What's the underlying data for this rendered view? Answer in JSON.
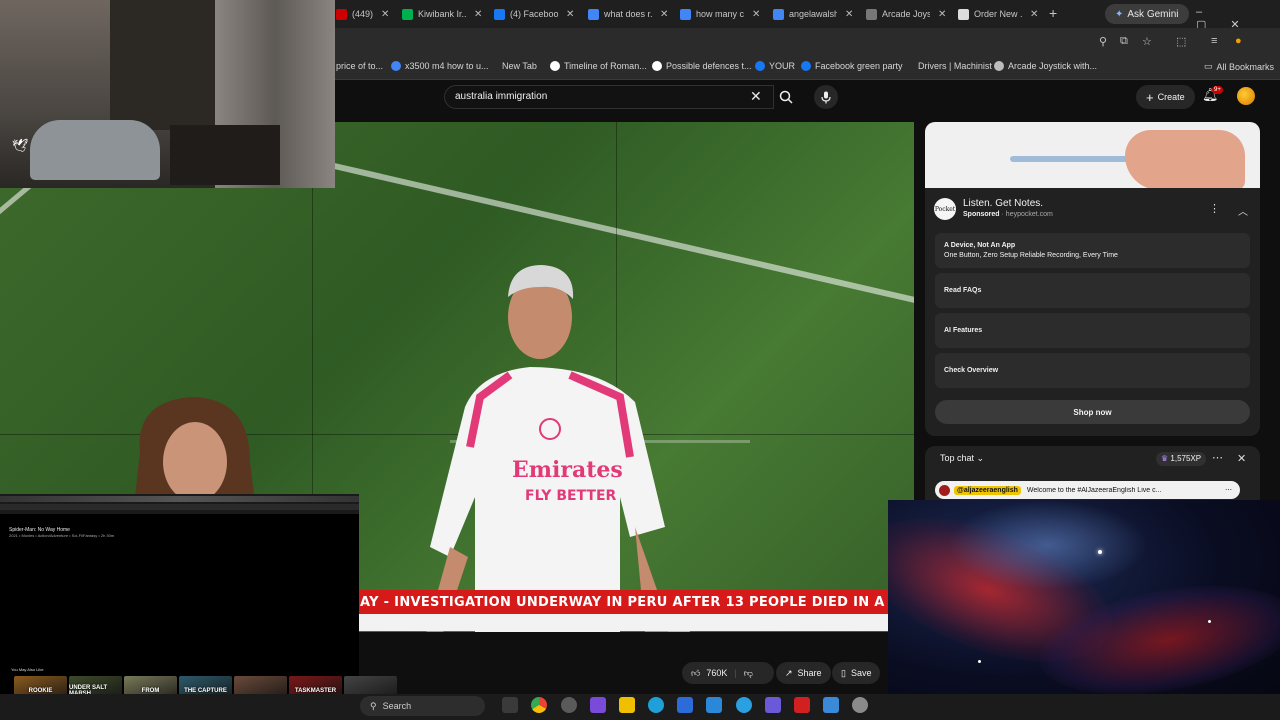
{
  "browser": {
    "tabs": [
      {
        "label": "(449)",
        "favicon_color": "#cc0000"
      },
      {
        "label": "Kiwibank Ir...",
        "favicon_color": "#00b04f"
      },
      {
        "label": "(4) Facebook",
        "favicon_color": "#1877f2"
      },
      {
        "label": "what does r...",
        "favicon_color": "#4285f4"
      },
      {
        "label": "how many c...",
        "favicon_color": "#4285f4"
      },
      {
        "label": "angelawalsh...",
        "favicon_color": "#4285f4"
      },
      {
        "label": "Arcade Joys...",
        "favicon_color": "#777777"
      },
      {
        "label": "Order New ...",
        "favicon_color": "#dddddd"
      }
    ],
    "ask_gemini": "Ask Gemini",
    "new_tab_glyph": "+",
    "bookmarks": [
      {
        "label": "price of to...",
        "favicon_color": ""
      },
      {
        "label": "x3500 m4 how to u...",
        "favicon_color": "#4285f4"
      },
      {
        "label": "New Tab",
        "favicon_color": ""
      },
      {
        "label": "Timeline of Roman...",
        "favicon_color": "#ffffff"
      },
      {
        "label": "Possible defences t...",
        "favicon_color": "#ffffff"
      },
      {
        "label": "YOUR",
        "favicon_color": "#1877f2"
      },
      {
        "label": "Facebook green party",
        "favicon_color": "#1877f2"
      },
      {
        "label": "Drivers | Machinist",
        "favicon_color": ""
      },
      {
        "label": "Arcade Joystick with...",
        "favicon_color": "#bbbbbb"
      }
    ],
    "all_bookmarks": "All Bookmarks"
  },
  "youtube": {
    "search_value": "australia immigration",
    "create_label": "Create",
    "notification_count": "9+"
  },
  "video": {
    "ticker_text": "AY  -  INVESTIGATION UNDERWAY IN PERU AFTER 13 PEOPLE DIED IN A",
    "shirt_text_1": "Emirates",
    "shirt_text_2": "FLY BETTER"
  },
  "actions": {
    "likes": "760K",
    "share": "Share",
    "save": "Save"
  },
  "ad": {
    "title": "Listen. Get Notes.",
    "sponsored": "Sponsored",
    "domain": "heypocket.com",
    "logo_text": "Pocket",
    "rows": [
      {
        "title": "A Device, Not An App",
        "subtitle": "One Button, Zero Setup Reliable Recording, Every Time"
      },
      {
        "title": "Read FAQs",
        "subtitle": ""
      },
      {
        "title": "AI Features",
        "subtitle": ""
      },
      {
        "title": "Check Overview",
        "subtitle": ""
      }
    ],
    "cta": "Shop now"
  },
  "chat": {
    "title": "Top chat",
    "xp": "1,575XP",
    "pinned_handle": "@aljazeeraenglish",
    "pinned_message": "Welcome to the #AlJazeeraEnglish Live c..."
  },
  "netflix": {
    "title": "Spider-Man: No Way Home",
    "meta": "2021 • Movies • Action/Adventure • Sci-Fi/Fantasy • 2h 30m",
    "more_like": "You May Also Like",
    "posters": [
      {
        "label": "ROOKIE",
        "color": "#8a5a1f"
      },
      {
        "label": "UNDER SALT MARSH",
        "color": "#3e4a2a"
      },
      {
        "label": "FROM",
        "color": "#7a7a5a"
      },
      {
        "label": "THE CAPTURE",
        "color": "#2d5a6a"
      },
      {
        "label": "",
        "color": "#6a4a3a"
      },
      {
        "label": "TASKMASTER",
        "color": "#7a1818"
      },
      {
        "label": "",
        "color": "#444444"
      }
    ]
  },
  "taskbar": {
    "search_placeholder": "Search"
  }
}
